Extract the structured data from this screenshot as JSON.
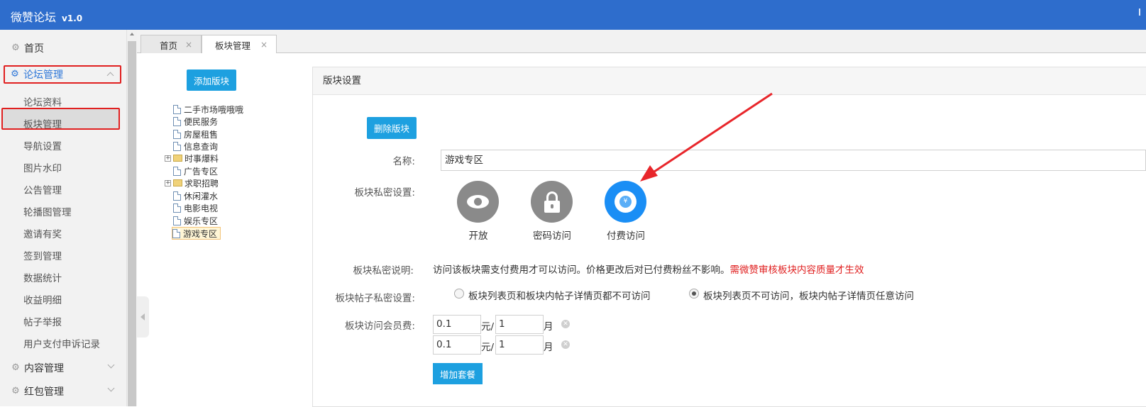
{
  "app": {
    "title": "微赞论坛",
    "version": "v1.0"
  },
  "sidebar": {
    "groups": [
      {
        "label": "首页"
      },
      {
        "label": "论坛管理"
      },
      {
        "label": "内容管理"
      },
      {
        "label": "红包管理"
      }
    ],
    "sub_items": [
      "论坛资料",
      "板块管理",
      "导航设置",
      "图片水印",
      "公告管理",
      "轮播图管理",
      "邀请有奖",
      "签到管理",
      "数据统计",
      "收益明细",
      "帖子举报",
      "用户支付申诉记录"
    ]
  },
  "tabs": [
    {
      "label": "首页",
      "close": "×"
    },
    {
      "label": "板块管理",
      "close": "×"
    }
  ],
  "tree": {
    "add_button": "添加版块",
    "items": [
      "二手市场哦哦哦",
      "便民服务",
      "房屋租售",
      "信息查询",
      "时事爆料",
      "广告专区",
      "求职招聘",
      "休闲灌水",
      "电影电视",
      "娱乐专区",
      "游戏专区"
    ],
    "expand_glyph": "+"
  },
  "panel": {
    "title": "版块设置",
    "delete_button": "删除版块",
    "name_label": "名称:",
    "name_value": "游戏专区",
    "privacy_label": "板块私密设置:",
    "privacy_options": [
      "开放",
      "密码访问",
      "付费访问"
    ],
    "privacy_selected": "付费访问",
    "yen_symbol": "¥",
    "desc_label": "板块私密说明:",
    "desc_text": "访问该板块需支付费用才可以访问。价格更改后对已付费粉丝不影响。",
    "desc_warning": "需微赞审核板块内容质量才生效",
    "post_privacy_label": "板块帖子私密设置:",
    "post_privacy_options": [
      "板块列表页和板块内帖子详情页都不可访问",
      "板块列表页不可访问，板块内帖子详情页任意访问"
    ],
    "post_privacy_selected": 1,
    "fee_label": "板块访问会员费:",
    "fees": [
      {
        "price": "0.1",
        "price_unit": "元/",
        "duration": "1",
        "duration_unit": "月",
        "clear": "✕"
      },
      {
        "price": "0.1",
        "price_unit": "元/",
        "duration": "1",
        "duration_unit": "月",
        "clear": "✕"
      }
    ],
    "add_plan_button": "增加套餐"
  },
  "colors": {
    "topbar": "#2e6dcc",
    "accent": "#1da0e0",
    "highlight_box": "#e02020",
    "warning": "#e02020",
    "selected_privacy": "#1a8ef5"
  }
}
